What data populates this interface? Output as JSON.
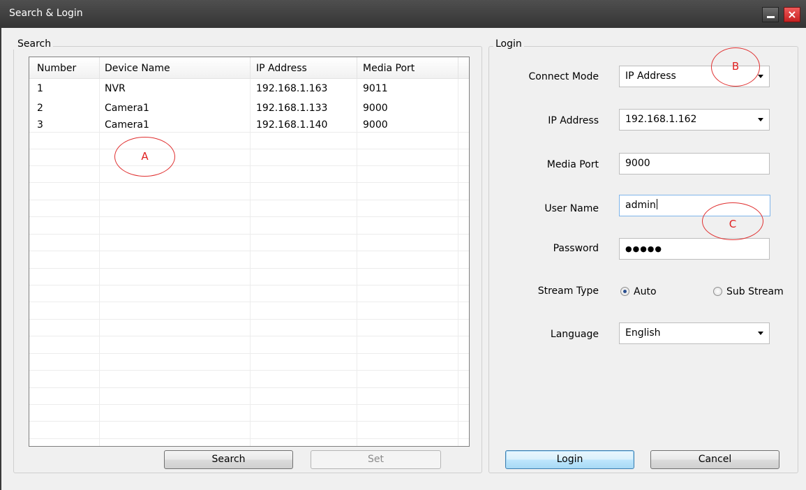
{
  "window": {
    "title": "Search & Login",
    "minimize_glyph": "",
    "close_glyph": "×"
  },
  "search": {
    "group_label": "Search",
    "columns": [
      "Number",
      "Device Name",
      "IP Address",
      "Media Port"
    ],
    "rows": [
      [
        "1",
        "NVR",
        "192.168.1.163",
        "9011"
      ],
      [
        "2",
        "Camera1",
        "192.168.1.133",
        "9000"
      ],
      [
        "3",
        "Camera1",
        "192.168.1.140",
        "9000"
      ]
    ],
    "search_button": "Search",
    "set_button": "Set"
  },
  "login": {
    "group_label": "Login",
    "connect_mode_label": "Connect Mode",
    "connect_mode_value": "IP Address",
    "ip_label": "IP Address",
    "ip_value": "192.168.1.162",
    "port_label": "Media Port",
    "port_value": "9000",
    "user_label": "User Name",
    "user_value": "admin",
    "password_label": "Password",
    "password_mask": "●●●●●",
    "stream_label": "Stream Type",
    "stream_auto": "Auto",
    "stream_sub": "Sub Stream",
    "language_label": "Language",
    "language_value": "English",
    "login_button": "Login",
    "cancel_button": "Cancel"
  },
  "annotations": {
    "a": "A",
    "b": "B",
    "c": "C"
  },
  "colors": {
    "annotation": "#e03030",
    "titlebar": "#3f3f3f",
    "close": "#d63030"
  }
}
